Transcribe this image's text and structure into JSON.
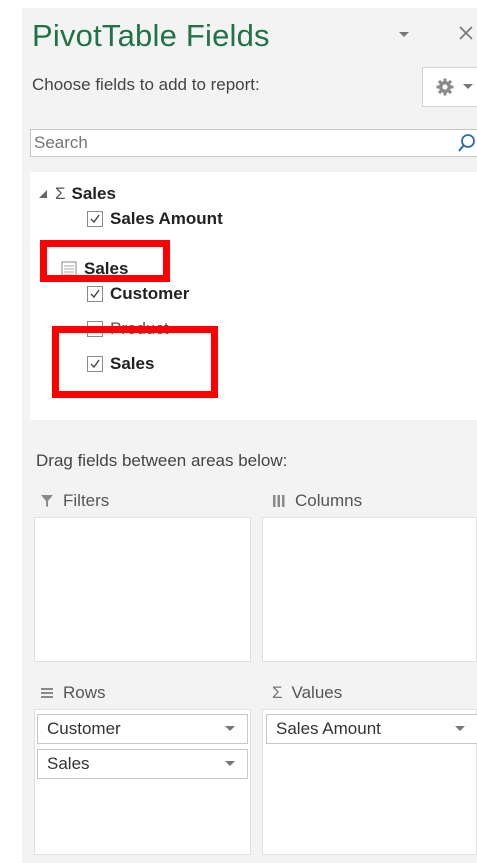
{
  "panel": {
    "title": "PivotTable Fields",
    "choose_label": "Choose fields to add to report:",
    "search_placeholder": "Search",
    "drag_label": "Drag fields between areas below:",
    "accent_color": "#217346",
    "highlight_color": "#ff0000"
  },
  "field_tree": {
    "measure_group": {
      "label": "Sales",
      "expanded": true,
      "fields": [
        {
          "label": "Sales Amount",
          "checked": true
        }
      ]
    },
    "table_group": {
      "label": "Sales",
      "fields": [
        {
          "label": "Customer",
          "checked": true
        },
        {
          "label": "Product",
          "checked": false
        },
        {
          "label": "Sales",
          "checked": true
        }
      ]
    }
  },
  "areas": {
    "filters": {
      "label": "Filters",
      "items": []
    },
    "columns": {
      "label": "Columns",
      "items": []
    },
    "rows": {
      "label": "Rows",
      "items": [
        "Customer",
        "Sales"
      ]
    },
    "values": {
      "label": "Values",
      "items": [
        "Sales Amount"
      ]
    }
  },
  "icons": {
    "title_menu": "chevron-down-icon",
    "close": "close-icon",
    "settings": "gear-icon",
    "search": "search-icon",
    "expand": "triangle-expanded-icon",
    "sigma": "sigma-icon",
    "table": "table-icon",
    "filter": "filter-icon",
    "columns": "columns-icon",
    "rows": "rows-icon"
  }
}
